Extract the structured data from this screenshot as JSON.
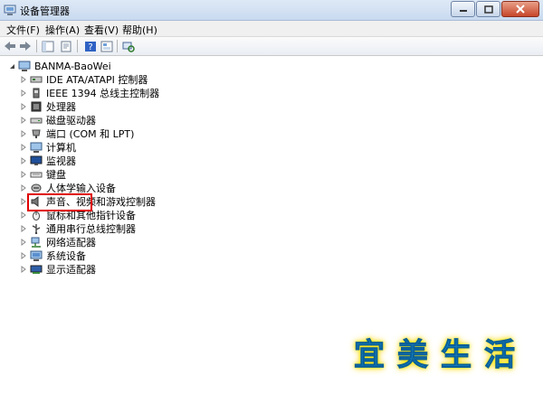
{
  "window": {
    "title": "设备管理器"
  },
  "menu": [
    {
      "name": "menu-file",
      "label": "文件(F)"
    },
    {
      "name": "menu-action",
      "label": "操作(A)"
    },
    {
      "name": "menu-view",
      "label": "查看(V)"
    },
    {
      "name": "menu-help",
      "label": "帮助(H)"
    }
  ],
  "toolbar": {
    "icons": [
      "back-icon",
      "forward-icon",
      "show-hide-tree-icon",
      "properties-icon",
      "help-icon",
      "view-icon",
      "scan-hardware-icon"
    ]
  },
  "tree": {
    "root": "BANMA-BaoWei",
    "items": [
      {
        "label": "IDE ATA/ATAPI 控制器",
        "icon": "ide-controller-icon"
      },
      {
        "label": "IEEE 1394 总线主控制器",
        "icon": "ieee1394-icon"
      },
      {
        "label": "处理器",
        "icon": "processor-icon"
      },
      {
        "label": "磁盘驱动器",
        "icon": "disk-drive-icon"
      },
      {
        "label": "端口 (COM 和 LPT)",
        "icon": "port-icon"
      },
      {
        "label": "计算机",
        "icon": "computer-icon"
      },
      {
        "label": "监视器",
        "icon": "monitor-icon"
      },
      {
        "label": "键盘",
        "icon": "keyboard-icon"
      },
      {
        "label": "人体学输入设备",
        "icon": "hid-icon"
      },
      {
        "label": "声音、视频和游戏控制器",
        "icon": "sound-icon"
      },
      {
        "label": "鼠标和其他指针设备",
        "icon": "mouse-icon"
      },
      {
        "label": "通用串行总线控制器",
        "icon": "usb-icon"
      },
      {
        "label": "网络适配器",
        "icon": "network-adapter-icon"
      },
      {
        "label": "系统设备",
        "icon": "system-device-icon"
      },
      {
        "label": "显示适配器",
        "icon": "display-adapter-icon"
      }
    ]
  },
  "watermark": [
    "宜",
    "美",
    "生",
    "活"
  ]
}
